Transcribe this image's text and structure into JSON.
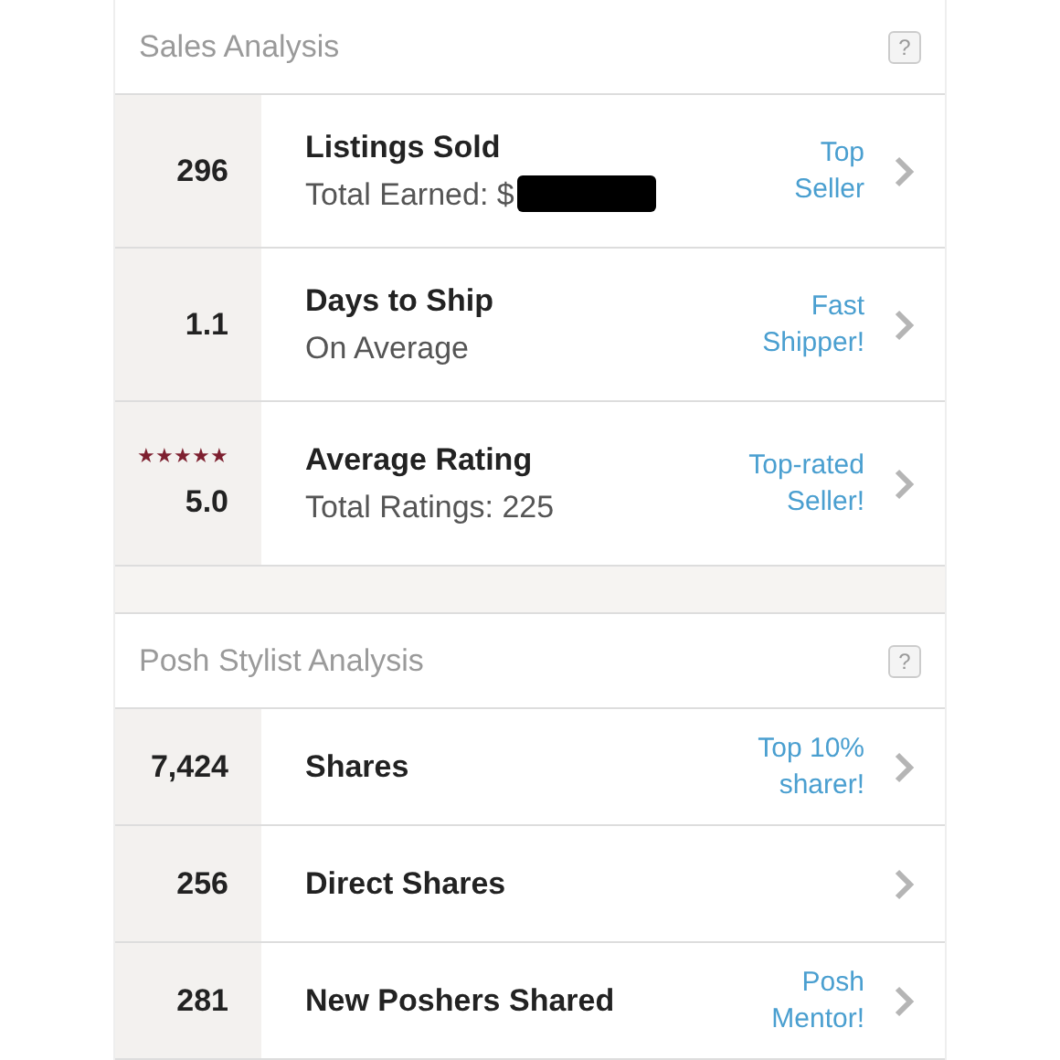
{
  "sections": [
    {
      "title": "Sales Analysis",
      "help_icon": "?",
      "rows": [
        {
          "value": "296",
          "title": "Listings Sold",
          "subtitle": "Total Earned: $",
          "redacted": true,
          "badge_lines": [
            "Top",
            "Seller"
          ]
        },
        {
          "value": "1.1",
          "title": "Days to Ship",
          "subtitle": "On Average",
          "badge_lines": [
            "Fast",
            "Shipper!"
          ]
        },
        {
          "value": "5.0",
          "stars": 5,
          "title": "Average Rating",
          "subtitle": "Total Ratings: 225",
          "badge_lines": [
            "Top-rated",
            "Seller!"
          ]
        }
      ]
    },
    {
      "title": "Posh Stylist Analysis",
      "help_icon": "?",
      "rows": [
        {
          "value": "7,424",
          "title": "Shares",
          "badge_lines": [
            "Top 10%",
            "sharer!"
          ]
        },
        {
          "value": "256",
          "title": "Direct Shares",
          "badge_lines": []
        },
        {
          "value": "281",
          "title": "New Poshers Shared",
          "badge_lines": [
            "Posh",
            "Mentor!"
          ]
        }
      ]
    }
  ]
}
